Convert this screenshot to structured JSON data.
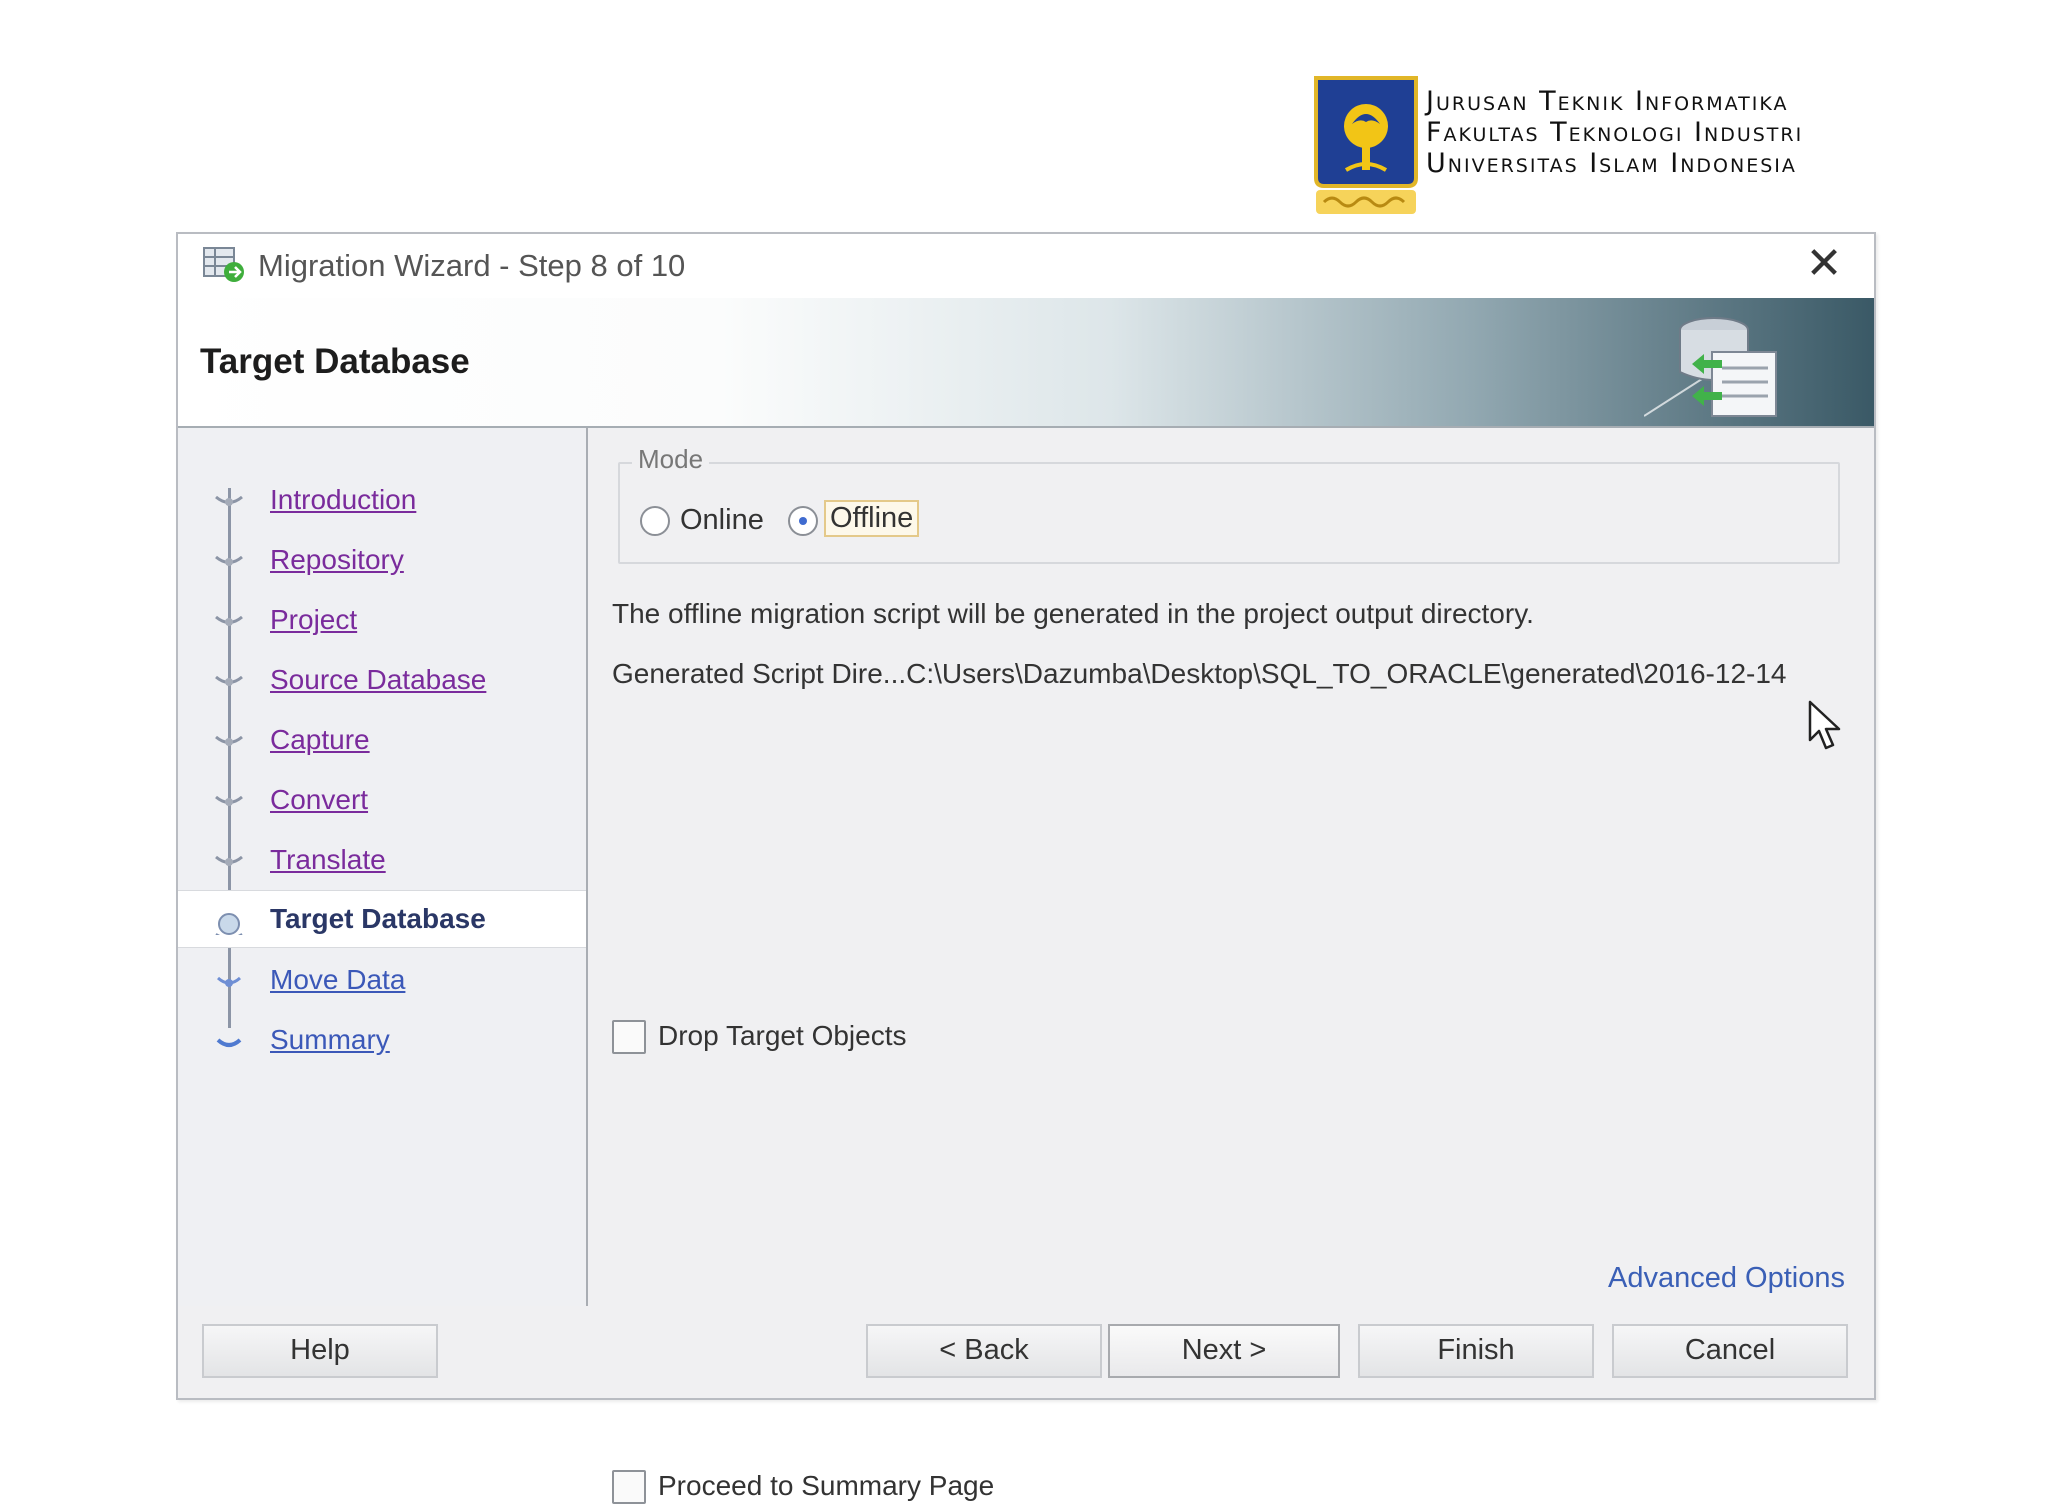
{
  "institution": {
    "lines": [
      "Jurusan Teknik Informatika",
      "Fakultas Teknologi Industri",
      "Universitas Islam Indonesia"
    ]
  },
  "dialog": {
    "title": "Migration Wizard - Step 8 of 10",
    "close_label": "✕",
    "page_title": "Target Database"
  },
  "nav": {
    "items": [
      {
        "label": "Introduction",
        "state": "done"
      },
      {
        "label": "Repository",
        "state": "done"
      },
      {
        "label": "Project",
        "state": "done"
      },
      {
        "label": "Source Database",
        "state": "done"
      },
      {
        "label": "Capture",
        "state": "done"
      },
      {
        "label": "Convert",
        "state": "done"
      },
      {
        "label": "Translate",
        "state": "done"
      },
      {
        "label": "Target Database",
        "state": "current"
      },
      {
        "label": "Move Data",
        "state": "future"
      },
      {
        "label": "Summary",
        "state": "future"
      }
    ]
  },
  "mode": {
    "legend": "Mode",
    "online_label": "Online",
    "offline_label": "Offline",
    "selected": "Offline"
  },
  "content": {
    "info_text": "The offline migration script will be generated in the project output directory.",
    "dir_label": "Generated Script Dire...",
    "dir_value": "C:\\Users\\Dazumba\\Desktop\\SQL_TO_ORACLE\\generated\\2016-12-14",
    "drop_target_label": "Drop Target Objects",
    "drop_target_checked": false,
    "proceed_label": "Proceed to Summary Page",
    "proceed_checked": false,
    "advanced_options": "Advanced Options"
  },
  "buttons": {
    "help": "Help",
    "back": "< Back",
    "next": "Next >",
    "finish": "Finish",
    "cancel": "Cancel"
  },
  "icons": {
    "app": "migration-wizard-icon",
    "banner": "database-migrate-icon",
    "cursor": "mouse-pointer-icon"
  },
  "colors": {
    "visited_link": "#7a2b9c",
    "future_link": "#3b58b8",
    "current_step": "#2a3766",
    "link_blue": "#3a5fb6"
  }
}
